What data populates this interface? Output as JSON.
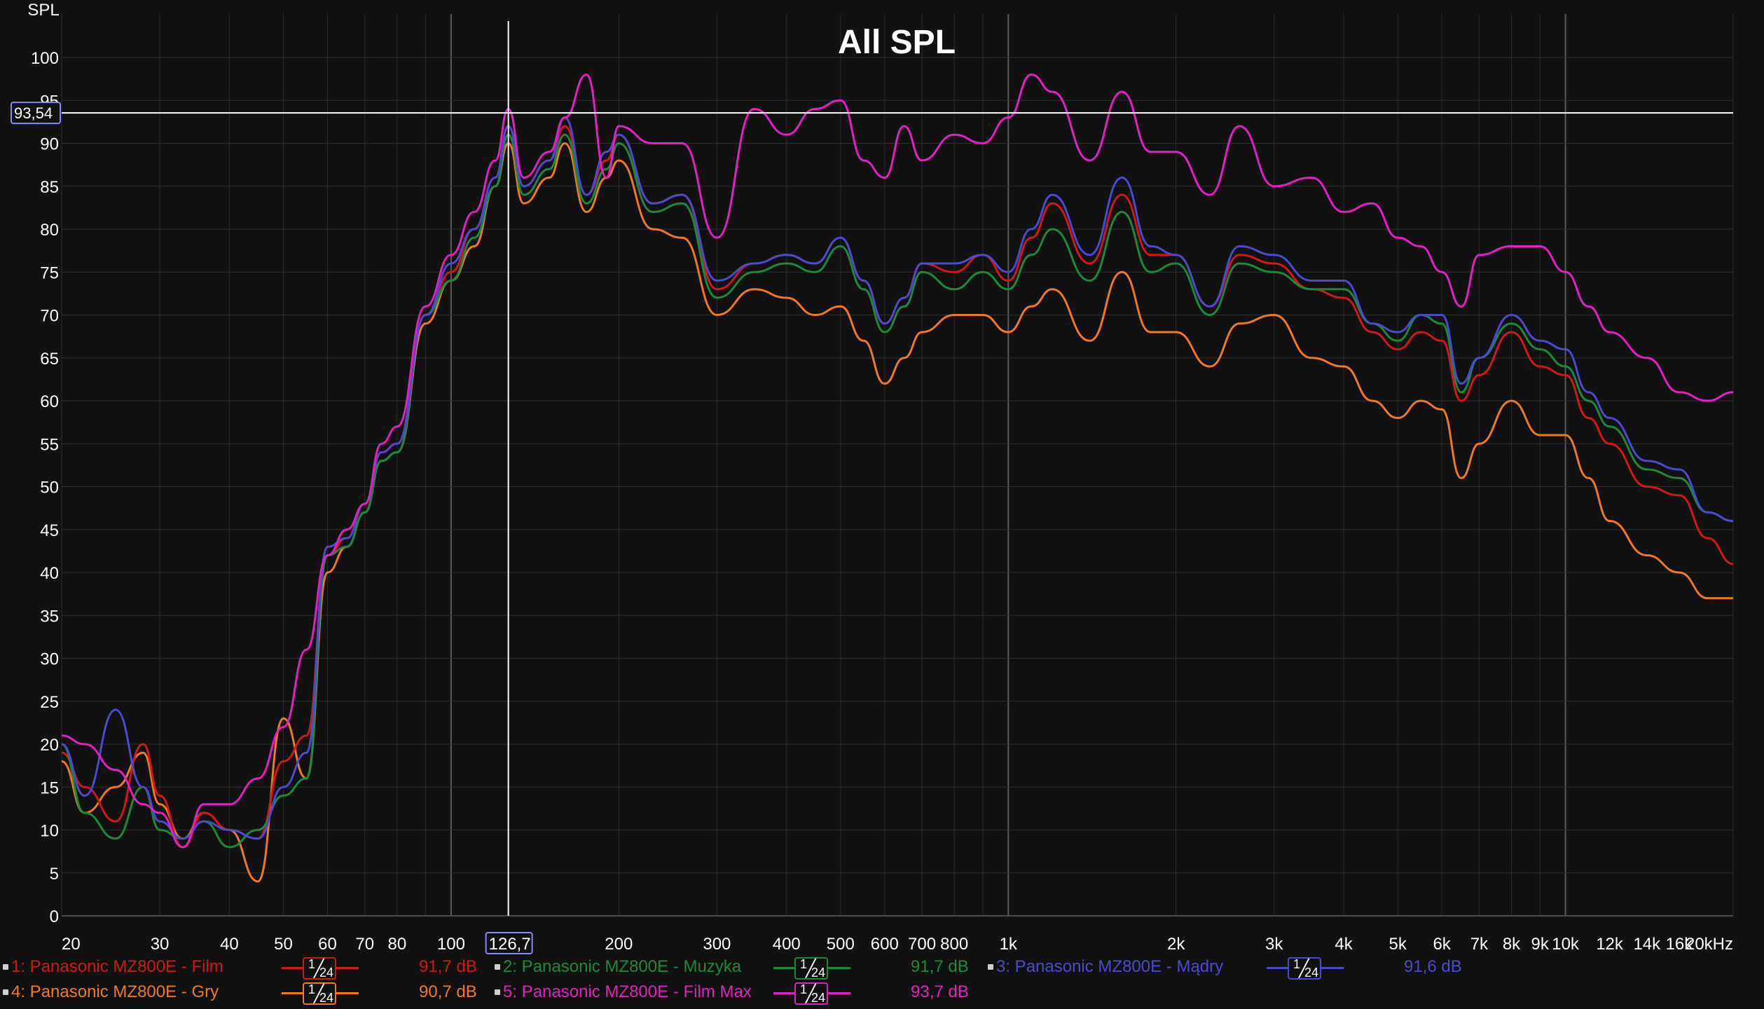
{
  "chart_data": {
    "type": "line",
    "title": "All SPL",
    "ylabel": "SPL",
    "xlabel": "",
    "x_scale": "log",
    "xlim": [
      20,
      20000
    ],
    "ylim": [
      0,
      100
    ],
    "y_ticks": [
      0,
      5,
      10,
      15,
      20,
      25,
      30,
      35,
      40,
      45,
      50,
      55,
      60,
      65,
      70,
      75,
      80,
      85,
      90,
      95,
      100
    ],
    "x_ticks": [
      {
        "v": 20,
        "label": "20"
      },
      {
        "v": 30,
        "label": "30"
      },
      {
        "v": 40,
        "label": "40"
      },
      {
        "v": 50,
        "label": "50"
      },
      {
        "v": 60,
        "label": "60"
      },
      {
        "v": 70,
        "label": "70"
      },
      {
        "v": 80,
        "label": "80"
      },
      {
        "v": 100,
        "label": "100"
      },
      {
        "v": 200,
        "label": "200"
      },
      {
        "v": 300,
        "label": "300"
      },
      {
        "v": 400,
        "label": "400"
      },
      {
        "v": 500,
        "label": "500"
      },
      {
        "v": 600,
        "label": "600"
      },
      {
        "v": 700,
        "label": "700"
      },
      {
        "v": 800,
        "label": "800"
      },
      {
        "v": 1000,
        "label": "1k"
      },
      {
        "v": 2000,
        "label": "2k"
      },
      {
        "v": 3000,
        "label": "3k"
      },
      {
        "v": 4000,
        "label": "4k"
      },
      {
        "v": 5000,
        "label": "5k"
      },
      {
        "v": 6000,
        "label": "6k"
      },
      {
        "v": 7000,
        "label": "7k"
      },
      {
        "v": 8000,
        "label": "8k"
      },
      {
        "v": 9000,
        "label": "9k"
      },
      {
        "v": 10000,
        "label": "10k"
      },
      {
        "v": 12000,
        "label": "12k"
      },
      {
        "v": 14000,
        "label": "14k"
      },
      {
        "v": 16000,
        "label": "16k"
      },
      {
        "v": 20000,
        "label": "20kHz"
      }
    ],
    "cursor": {
      "x": 126.7,
      "y": 93.54,
      "x_label": "126,7",
      "y_label": "93,54"
    },
    "x": [
      20,
      22,
      25,
      28,
      30,
      33,
      36,
      40,
      45,
      50,
      55,
      60,
      65,
      70,
      75,
      80,
      90,
      100,
      110,
      120,
      126.7,
      135,
      150,
      160,
      175,
      190,
      200,
      230,
      260,
      300,
      350,
      400,
      450,
      500,
      550,
      600,
      650,
      700,
      800,
      900,
      1000,
      1100,
      1200,
      1400,
      1600,
      1800,
      2000,
      2300,
      2600,
      3000,
      3500,
      4000,
      4500,
      5000,
      5500,
      6000,
      6500,
      7000,
      8000,
      9000,
      10000,
      11000,
      12000,
      14000,
      16000,
      18000,
      20000
    ],
    "series": [
      {
        "name": "1: Panasonic MZ800E - Film",
        "color": "#d01818",
        "level": "91,7 dB",
        "values": [
          19,
          15,
          11,
          20,
          14,
          8,
          12,
          10,
          9,
          18,
          21,
          42,
          44,
          48,
          54,
          55,
          70,
          75,
          80,
          86,
          92,
          85,
          88,
          92,
          84,
          88,
          91,
          83,
          84,
          73,
          76,
          77,
          76,
          79,
          74,
          69,
          72,
          76,
          75,
          77,
          74,
          79,
          83,
          76,
          84,
          77,
          77,
          71,
          77,
          76,
          73,
          72,
          68,
          66,
          68,
          67,
          60,
          63,
          68,
          64,
          63,
          58,
          55,
          50,
          49,
          44,
          41
        ]
      },
      {
        "name": "2: Panasonic MZ800E - Muzyka",
        "color": "#1a8a3a",
        "level": "91,7 dB",
        "values": [
          20,
          12,
          9,
          15,
          10,
          9,
          11,
          8,
          10,
          14,
          16,
          42,
          43,
          47,
          53,
          54,
          70,
          74,
          79,
          85,
          91,
          84,
          87,
          91,
          83,
          87,
          90,
          82,
          83,
          72,
          75,
          76,
          75,
          78,
          73,
          68,
          71,
          75,
          73,
          75,
          73,
          77,
          80,
          74,
          82,
          75,
          76,
          70,
          76,
          75,
          73,
          73,
          69,
          67,
          70,
          69,
          61,
          65,
          69,
          66,
          64,
          60,
          57,
          52,
          51,
          47,
          46
        ]
      },
      {
        "name": "3: Panasonic MZ800E - Mądry",
        "color": "#4a4ad0",
        "level": "91,6 dB",
        "values": [
          20,
          14,
          24,
          15,
          11,
          9,
          11,
          10,
          9,
          15,
          19,
          43,
          44,
          48,
          54,
          55,
          70,
          76,
          80,
          86,
          92,
          85,
          88,
          93,
          84,
          89,
          91,
          83,
          84,
          74,
          76,
          77,
          76,
          79,
          74,
          69,
          72,
          76,
          76,
          77,
          75,
          80,
          84,
          77,
          86,
          78,
          77,
          71,
          78,
          77,
          74,
          74,
          69,
          68,
          70,
          70,
          62,
          65,
          70,
          67,
          66,
          61,
          58,
          53,
          52,
          47,
          46
        ]
      },
      {
        "name": "4: Panasonic MZ800E - Gry",
        "color": "#f07820",
        "level": "90,7 dB",
        "values": [
          18,
          12,
          15,
          19,
          13,
          9,
          12,
          10,
          4,
          23,
          16,
          40,
          43,
          47,
          53,
          54,
          69,
          74,
          78,
          85,
          90,
          83,
          86,
          90,
          82,
          86,
          88,
          80,
          79,
          70,
          73,
          72,
          70,
          71,
          67,
          62,
          65,
          68,
          70,
          70,
          68,
          71,
          73,
          67,
          75,
          68,
          68,
          64,
          69,
          70,
          65,
          64,
          60,
          58,
          60,
          59,
          51,
          55,
          60,
          56,
          56,
          51,
          46,
          42,
          40,
          37,
          37
        ]
      },
      {
        "name": "5: Panasonic MZ800E - Film Max",
        "color": "#e020c0",
        "level": "93,7 dB",
        "values": [
          21,
          20,
          17,
          13,
          12,
          8,
          13,
          13,
          16,
          22,
          31,
          42,
          45,
          48,
          55,
          57,
          71,
          77,
          82,
          88,
          94,
          86,
          89,
          93,
          98,
          86,
          92,
          90,
          90,
          79,
          94,
          91,
          94,
          95,
          88,
          86,
          92,
          88,
          91,
          90,
          93,
          98,
          96,
          88,
          96,
          89,
          89,
          84,
          92,
          85,
          86,
          82,
          83,
          79,
          78,
          75,
          71,
          77,
          78,
          78,
          75,
          71,
          68,
          65,
          61,
          60,
          61
        ]
      }
    ]
  }
}
